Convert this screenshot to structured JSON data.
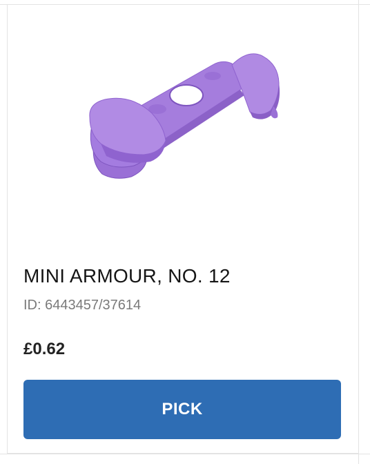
{
  "product": {
    "name": "MINI ARMOUR, NO. 12",
    "element_id": "ID: 6443457/37614",
    "price": "£0.62",
    "image_icon": "mini-armour-brick-image",
    "part_color": "#a57ddd"
  },
  "actions": {
    "pick_label": "PICK",
    "pick_color": "#2e6db4"
  }
}
